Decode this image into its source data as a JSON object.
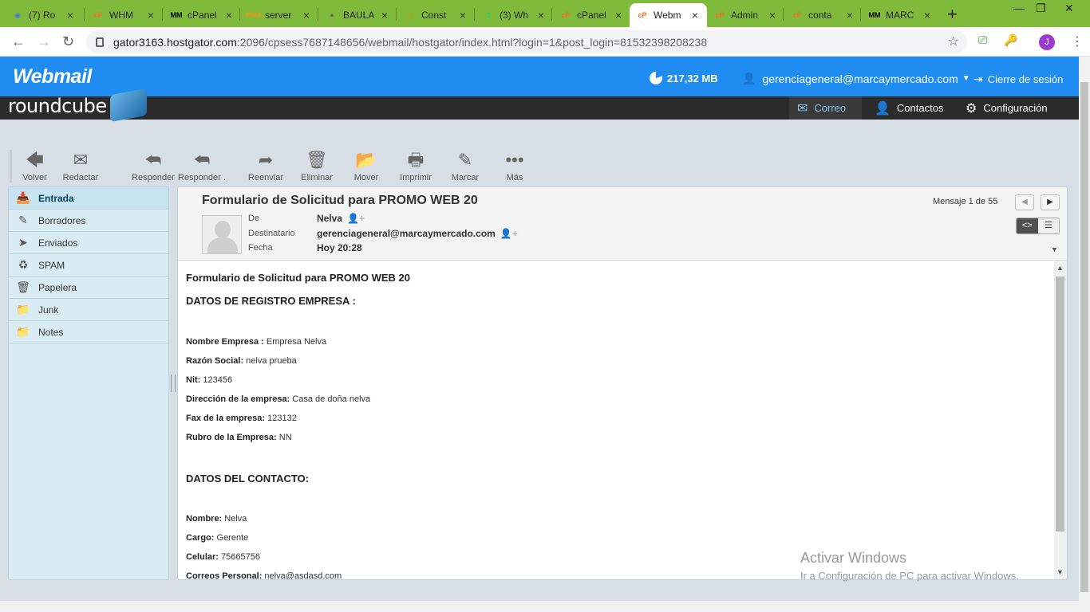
{
  "browser": {
    "tabs": [
      {
        "title": "(7) Ro",
        "fav": "◉",
        "favcolor": "#3b7ad9"
      },
      {
        "title": "WHM",
        "fav": "cP",
        "favcolor": "#ff6c2c"
      },
      {
        "title": "cPanel",
        "fav": "MM",
        "favcolor": "#000000"
      },
      {
        "title": "server",
        "fav": "PMA",
        "favcolor": "#f29111"
      },
      {
        "title": "BAULA",
        "fav": "●",
        "favcolor": "#666666"
      },
      {
        "title": "Const",
        "fav": "◎",
        "favcolor": "#c79b00"
      },
      {
        "title": "(3) Wh",
        "fav": "3",
        "favcolor": "#25d366"
      },
      {
        "title": "cPanel",
        "fav": "cP",
        "favcolor": "#ff6c2c"
      },
      {
        "title": "Webm",
        "fav": "cP",
        "favcolor": "#ff6c2c"
      },
      {
        "title": "Admin",
        "fav": "cP",
        "favcolor": "#ff6c2c"
      },
      {
        "title": "conta",
        "fav": "cP",
        "favcolor": "#ff6c2c"
      },
      {
        "title": "MARC",
        "fav": "MM",
        "favcolor": "#000000"
      }
    ],
    "active_tab": 8,
    "url_host": "gator3163.hostgator.com",
    "url_path": ":2096/cpsess7687148656/webmail/hostgator/index.html?login=1&post_login=81532398208238",
    "profile_initial": "J"
  },
  "webmail": {
    "logo": "Webmail",
    "disk_usage": "217,32 MB",
    "user": "gerenciageneral@marcaymercado.com",
    "logout": "Cierre de sesión"
  },
  "roundcube": {
    "logo": "roundcube",
    "nav": [
      {
        "label": "Correo",
        "icon": "✉"
      },
      {
        "label": "Contactos",
        "icon": "👤"
      },
      {
        "label": "Configuración",
        "icon": "⚙"
      }
    ]
  },
  "toolbar": [
    {
      "label": "Volver",
      "icon": "🡄"
    },
    {
      "label": "Redactar",
      "icon": "✉"
    },
    {
      "label": "Responder",
      "icon": "⮪"
    },
    {
      "label": "Responder ...",
      "icon": "⮪"
    },
    {
      "label": "Reenviar",
      "icon": "➦"
    },
    {
      "label": "Eliminar",
      "icon": "🗑"
    },
    {
      "label": "Mover",
      "icon": "📂"
    },
    {
      "label": "Imprimir",
      "icon": "🖶"
    },
    {
      "label": "Marcar",
      "icon": "✎"
    },
    {
      "label": "Más",
      "icon": "•••"
    }
  ],
  "folders": [
    {
      "label": "Entrada",
      "icon": "📥"
    },
    {
      "label": "Borradores",
      "icon": "✎"
    },
    {
      "label": "Enviados",
      "icon": "➤"
    },
    {
      "label": "SPAM",
      "icon": "♻"
    },
    {
      "label": "Papelera",
      "icon": "🗑"
    },
    {
      "label": "Junk",
      "icon": "📁"
    },
    {
      "label": "Notes",
      "icon": "📁"
    }
  ],
  "message": {
    "subject": "Formulario de Solicitud para PROMO WEB 20",
    "from_label": "De",
    "from": "Nelva",
    "to_label": "Destinatario",
    "to": "gerenciageneral@marcaymercado.com",
    "date_label": "Fecha",
    "date": "Hoy 20:28",
    "counter": "Mensaje 1 de 55"
  },
  "body": {
    "title": "Formulario de Solicitud para PROMO WEB 20",
    "section1": "DATOS DE REGISTRO EMPRESA :",
    "fields1": [
      {
        "k": "Nombre Empresa :",
        "v": " Empresa Nelva"
      },
      {
        "k": "Razón Social:",
        "v": " nelva prueba"
      },
      {
        "k": "Nit:",
        "v": " 123456"
      },
      {
        "k": "Dirección de la empresa:",
        "v": " Casa de doña nelva"
      },
      {
        "k": "Fax de la empresa:",
        "v": " 123132"
      },
      {
        "k": "Rubro de la Empresa:",
        "v": " NN"
      }
    ],
    "section2": "DATOS DEL CONTACTO:",
    "fields2": [
      {
        "k": "Nombre:",
        "v": " Nelva"
      },
      {
        "k": "Cargo:",
        "v": " Gerente"
      },
      {
        "k": "Celular:",
        "v": " 75665756"
      },
      {
        "k": "Correos Personal:",
        "v": " nelva@asdasd.com"
      }
    ]
  },
  "windows_watermark": {
    "line1": "Activar Windows",
    "line2": "Ir a Configuración de PC para activar Windows."
  }
}
